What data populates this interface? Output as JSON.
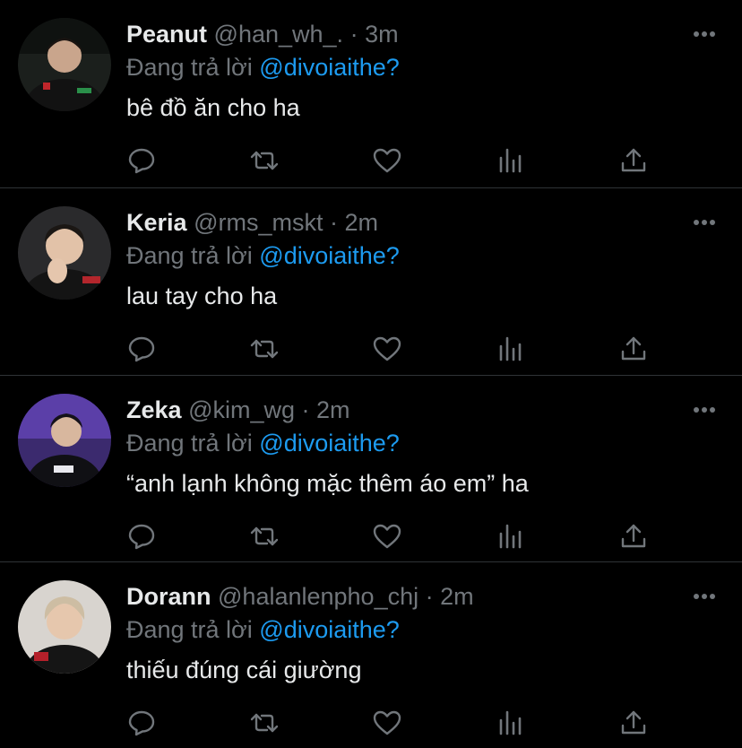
{
  "reply_prefix": "Đang trả lời",
  "colors": {
    "background": "#000000",
    "text": "#e7e9ea",
    "muted": "#71767b",
    "mention": "#1d9bf0",
    "divider": "#2f3336"
  },
  "actions": [
    "reply-icon",
    "retweet-icon",
    "like-icon",
    "views-icon",
    "share-icon"
  ],
  "tweets": [
    {
      "name": "Peanut",
      "handle": "@han_wh_.",
      "separator": "·",
      "time": "3m",
      "replying_to": "@divoiaithe?",
      "text": "bê đồ ăn cho ha"
    },
    {
      "name": "Keria",
      "handle": "@rms_mskt",
      "separator": "·",
      "time": "2m",
      "replying_to": "@divoiaithe?",
      "text": "lau tay cho ha"
    },
    {
      "name": "Zeka",
      "handle": "@kim_wg",
      "separator": "·",
      "time": "2m",
      "replying_to": "@divoiaithe?",
      "text": "“anh lạnh không mặc thêm áo em” ha"
    },
    {
      "name": "Dorann",
      "handle": "@halanlenpho_chj",
      "separator": "·",
      "time": "2m",
      "replying_to": "@divoiaithe?",
      "text": "thiếu đúng cái giường"
    }
  ]
}
